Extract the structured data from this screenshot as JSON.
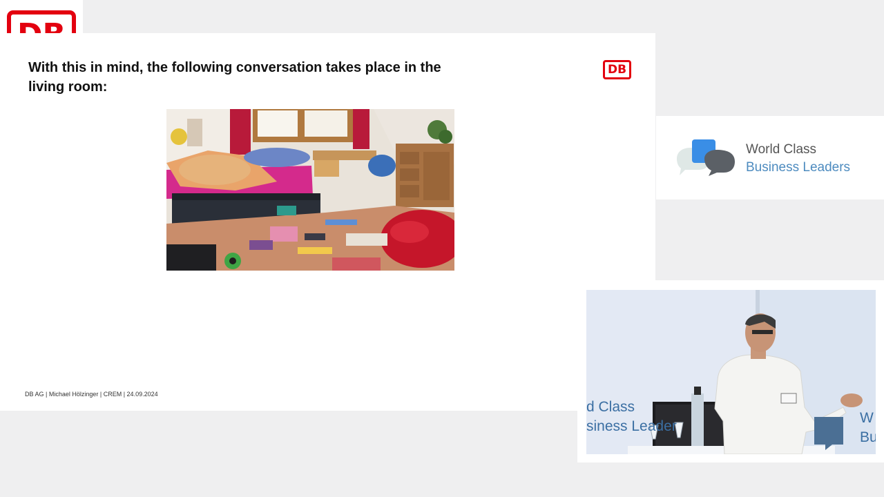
{
  "corner_logo": {
    "text": "DB"
  },
  "slide": {
    "heading": "With this in mind, the following conversation takes place in the living room:",
    "logo_text": "DB",
    "photo": {
      "icon": "messy-bedroom-photo"
    },
    "footer": "DB AG | Michael Hölzinger | CREM | 24.09.2024"
  },
  "brand": {
    "line1": "World Class",
    "line2": "Business Leaders",
    "colors": {
      "blue": "#2f7fd6",
      "gray": "#5a5f66",
      "accent_text": "#4d8bbf"
    }
  },
  "video": {
    "backdrop_line1": "d Class",
    "backdrop_line2": "siness Leader",
    "backdrop_right1": "W",
    "backdrop_right2": "Bu"
  },
  "colors": {
    "db_red": "#e3000f",
    "background": "#efeff0"
  }
}
